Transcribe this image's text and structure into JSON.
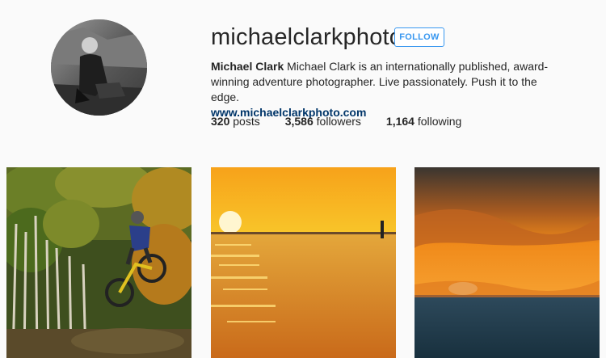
{
  "profile": {
    "username": "michaelclarkphoto",
    "follow_label": "FOLLOW",
    "full_name": "Michael Clark",
    "bio": "Michael Clark is an internationally published, award-winning adventure photographer. Live passionately. Push it to the edge.",
    "website": "www.michaelclarkphoto.com"
  },
  "stats": {
    "posts_count": "320",
    "posts_label": "posts",
    "followers_count": "3,586",
    "followers_label": "followers",
    "following_count": "1,164",
    "following_label": "following"
  },
  "colors": {
    "accent": "#3897f0",
    "link": "#003569",
    "background": "#fafafa"
  },
  "posts": [
    {
      "subject": "mountain-bike-jump-aspens"
    },
    {
      "subject": "sunset-over-water-yellow"
    },
    {
      "subject": "sunset-over-ocean-orange"
    }
  ]
}
